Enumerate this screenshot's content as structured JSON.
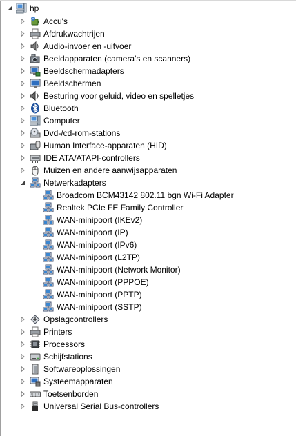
{
  "tree": {
    "root": {
      "label": "hp",
      "icon": "computer-icon"
    },
    "categories": [
      {
        "label": "Accu's",
        "icon": "battery-icon",
        "expanded": false
      },
      {
        "label": "Afdrukwachtrijen",
        "icon": "printer-icon",
        "expanded": false
      },
      {
        "label": "Audio-invoer en -uitvoer",
        "icon": "speaker-icon",
        "expanded": false
      },
      {
        "label": "Beeldapparaten (camera's en scanners)",
        "icon": "camera-icon",
        "expanded": false
      },
      {
        "label": "Beeldschermadapters",
        "icon": "display-adapter-icon",
        "expanded": false
      },
      {
        "label": "Beeldschermen",
        "icon": "monitor-icon",
        "expanded": false
      },
      {
        "label": "Besturing voor geluid, video en spelletjes",
        "icon": "sound-icon",
        "expanded": false
      },
      {
        "label": "Bluetooth",
        "icon": "bluetooth-icon",
        "expanded": false
      },
      {
        "label": "Computer",
        "icon": "computer-icon",
        "expanded": false
      },
      {
        "label": "Dvd-/cd-rom-stations",
        "icon": "optical-drive-icon",
        "expanded": false
      },
      {
        "label": "Human Interface-apparaten (HID)",
        "icon": "hid-icon",
        "expanded": false
      },
      {
        "label": "IDE ATA/ATAPI-controllers",
        "icon": "ide-controller-icon",
        "expanded": false
      },
      {
        "label": "Muizen en andere aanwijsapparaten",
        "icon": "mouse-icon",
        "expanded": false
      },
      {
        "label": "Netwerkadapters",
        "icon": "network-adapter-icon",
        "expanded": true
      },
      {
        "label": "Opslagcontrollers",
        "icon": "storage-controller-icon",
        "expanded": false
      },
      {
        "label": "Printers",
        "icon": "printer-icon",
        "expanded": false
      },
      {
        "label": "Processors",
        "icon": "processor-icon",
        "expanded": false
      },
      {
        "label": "Schijfstations",
        "icon": "disk-drive-icon",
        "expanded": false
      },
      {
        "label": "Softwareoplossingen",
        "icon": "software-icon",
        "expanded": false
      },
      {
        "label": "Systeemapparaten",
        "icon": "system-devices-icon",
        "expanded": false
      },
      {
        "label": "Toetsenborden",
        "icon": "keyboard-icon",
        "expanded": false
      },
      {
        "label": "Universal Serial Bus-controllers",
        "icon": "usb-icon",
        "expanded": false
      }
    ],
    "network_adapters": [
      "Broadcom BCM43142 802.11 bgn Wi-Fi Adapter",
      "Realtek PCIe FE Family Controller",
      "WAN-minipoort (IKEv2)",
      "WAN-minipoort (IP)",
      "WAN-minipoort (IPv6)",
      "WAN-minipoort (L2TP)",
      "WAN-minipoort (Network Monitor)",
      "WAN-minipoort (PPPOE)",
      "WAN-minipoort (PPTP)",
      "WAN-minipoort (SSTP)"
    ]
  },
  "colors": {
    "chevron": "#7f7f7f",
    "chevron_expanded": "#404040",
    "frame": "#a0a0a0",
    "background": "#ffffff"
  }
}
